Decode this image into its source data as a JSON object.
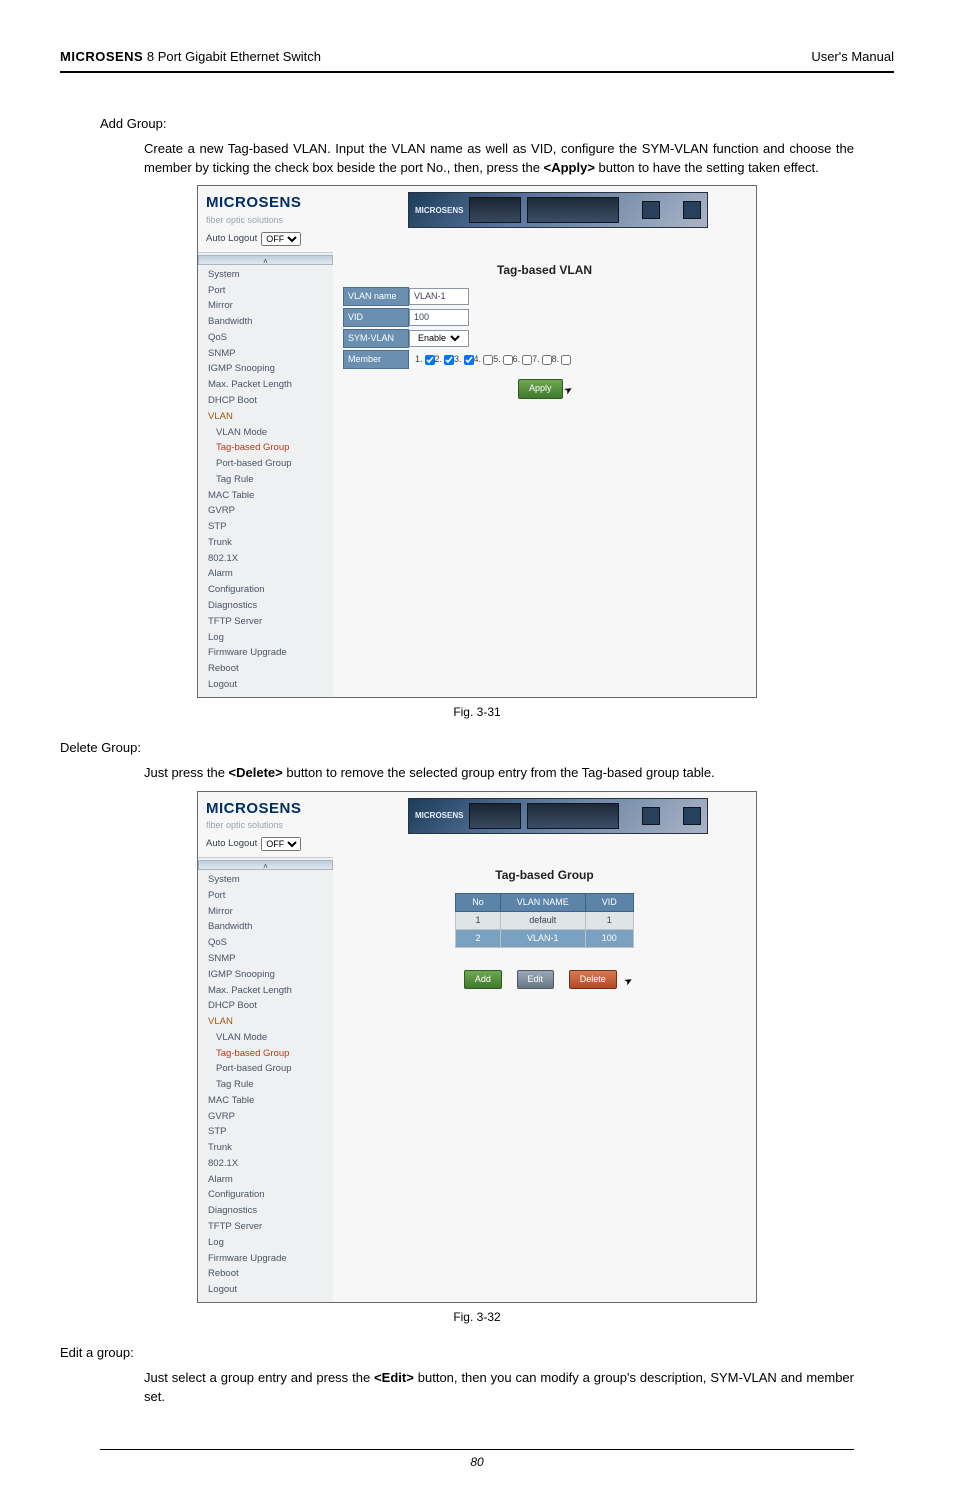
{
  "header": {
    "brand": "MICROSENS",
    "product": "8 Port Gigabit Ethernet Switch",
    "right": "User's Manual"
  },
  "s1": {
    "heading": "Add Group:",
    "para_parts": [
      "Create a new Tag-based VLAN. Input the VLAN name as well as VID, configure the SYM-VLAN function and choose the member by ticking the check box beside the port No., then, press the ",
      "<Apply>",
      " button to have the setting taken effect."
    ]
  },
  "shot_common": {
    "brand": "MICROSENS",
    "brand_sub": "fiber optic solutions",
    "auto_logout_label": "Auto Logout",
    "auto_logout_value": "OFF",
    "banner_text": "MICROSENS"
  },
  "nav": {
    "items": [
      "System",
      "Port",
      "Mirror",
      "Bandwidth",
      "QoS",
      "SNMP",
      "IGMP Snooping",
      "Max. Packet Length",
      "DHCP Boot",
      "VLAN",
      "VLAN Mode",
      "Tag-based Group",
      "Port-based Group",
      "Tag Rule",
      "MAC Table",
      "GVRP",
      "STP",
      "Trunk",
      "802.1X",
      "Alarm",
      "Configuration",
      "Diagnostics",
      "TFTP Server",
      "Log",
      "Firmware Upgrade",
      "Reboot",
      "Logout"
    ]
  },
  "shot1": {
    "title": "Tag-based VLAN",
    "fields": {
      "vlan_name_lbl": "VLAN name",
      "vlan_name_val": "VLAN-1",
      "vid_lbl": "VID",
      "vid_val": "100",
      "sym_lbl": "SYM-VLAN",
      "sym_val": "Enable",
      "member_lbl": "Member"
    },
    "members": [
      "1.",
      "2.",
      "3.",
      "4.",
      "5.",
      "6.",
      "7.",
      "8."
    ],
    "members_checked": [
      true,
      true,
      true,
      false,
      false,
      false,
      false,
      false
    ],
    "apply": "Apply"
  },
  "fig1": "Fig. 3-31",
  "s2": {
    "heading": "Delete Group:",
    "para_parts": [
      "Just press the ",
      "<Delete>",
      " button to remove the selected group entry from the Tag-based group table."
    ]
  },
  "shot2": {
    "title": "Tag-based Group",
    "cols": [
      "No",
      "VLAN NAME",
      "VID"
    ],
    "rows": [
      {
        "no": "1",
        "name": "default",
        "vid": "1",
        "hi": false
      },
      {
        "no": "2",
        "name": "VLAN-1",
        "vid": "100",
        "hi": true
      }
    ],
    "buttons": {
      "add": "Add",
      "edit": "Edit",
      "del": "Delete"
    }
  },
  "fig2": "Fig. 3-32",
  "s3": {
    "heading": "Edit a group:",
    "para_parts": [
      "Just select a group entry and press the  ",
      "<Edit>",
      "  button, then you can modify a group's description, SYM-VLAN and member set."
    ]
  },
  "page_number": "80"
}
